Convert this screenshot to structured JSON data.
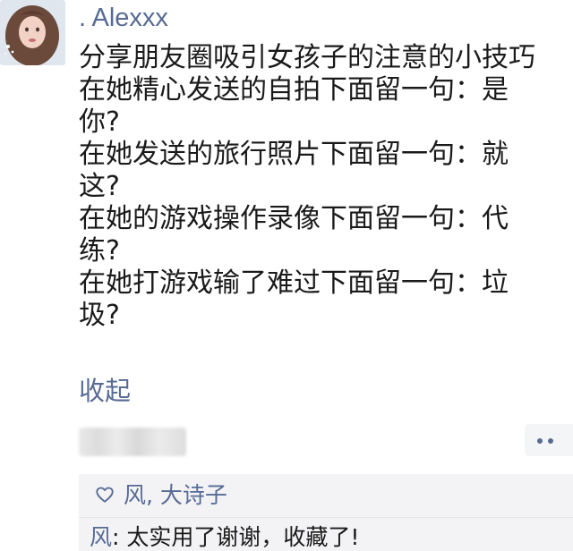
{
  "post": {
    "author": ". Alexxx",
    "lines": [
      "分享朋友圈吸引女孩子的注意的小技巧",
      "在她精心发送的自拍下面留一句：是",
      "你?",
      "在她发送的旅行照片下面留一句：就",
      "这?",
      "在她的游戏操作录像下面留一句：代",
      "练?",
      "在她打游戏输了难过下面留一句：垃",
      "圾?"
    ],
    "collapse_label": "收起",
    "more_icon": "ellipsis-icon"
  },
  "interactions": {
    "like_icon": "heart-icon",
    "likers": "风, 大诗子",
    "comment": {
      "name": "风",
      "separator": ": ",
      "text": "太实用了谢谢，收藏了!"
    }
  },
  "colors": {
    "link": "#576b95",
    "text": "#1a1a1a",
    "panel": "#f3f3f5"
  }
}
